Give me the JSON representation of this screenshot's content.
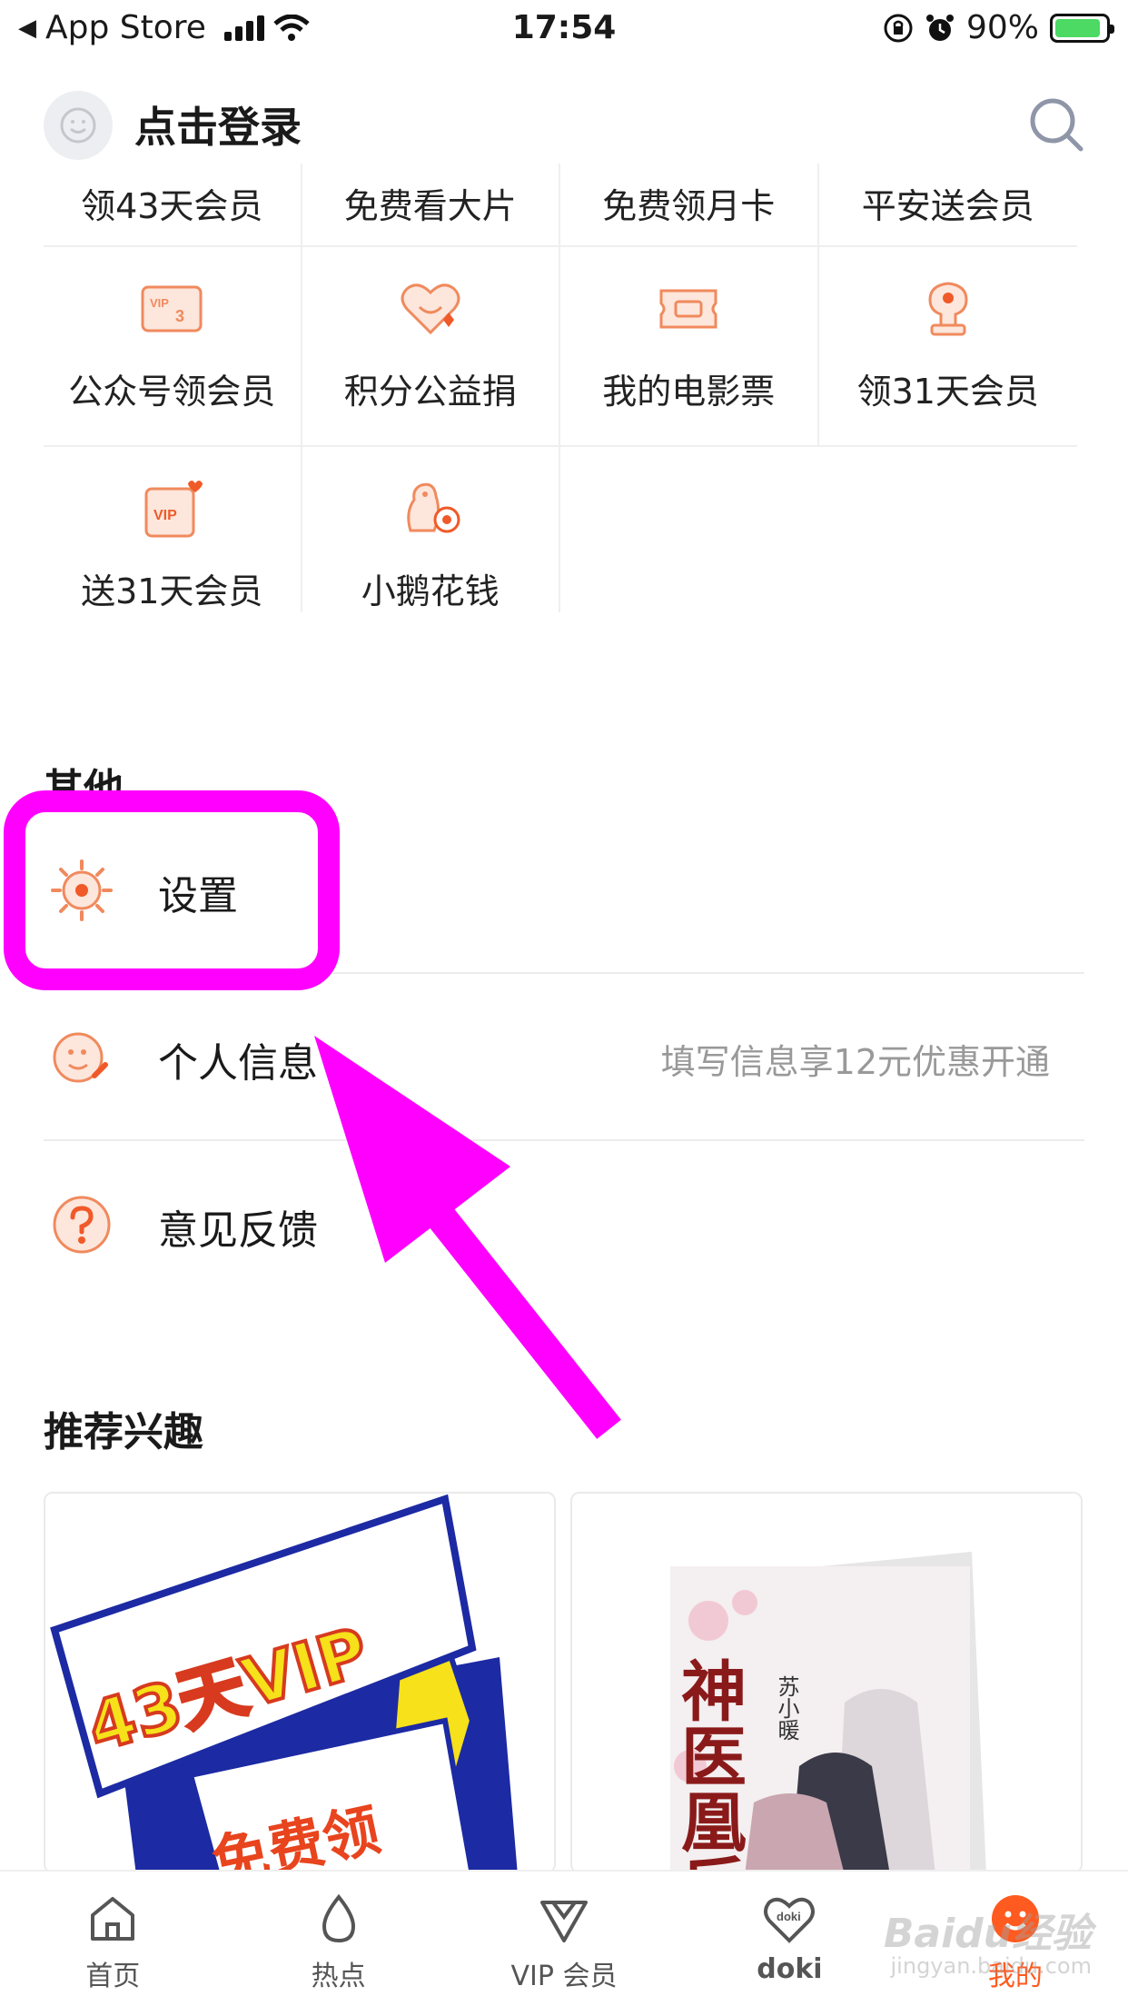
{
  "status_bar": {
    "back_app": "App Store",
    "time": "17:54",
    "battery": "90%"
  },
  "header": {
    "login_title": "点击登录"
  },
  "services": {
    "row_cut": [
      "领43天会员",
      "免费看大片",
      "免费领月卡",
      "平安送会员"
    ],
    "row_a": [
      "公众号领会员",
      "积分公益捐",
      "我的电影票",
      "领31天会员"
    ],
    "row_b": [
      "送31天会员",
      "小鹅花钱"
    ]
  },
  "other": {
    "title": "其他",
    "items": [
      {
        "label": "设置",
        "hint": ""
      },
      {
        "label": "个人信息",
        "hint": "填写信息享12元优惠开通"
      },
      {
        "label": "意见反馈",
        "hint": ""
      }
    ]
  },
  "recommend": {
    "title": "推荐兴趣",
    "card1_line1": "43天VIP",
    "card1_line2": "免费领",
    "card2_title": "神医凰后",
    "card2_author": "苏小暖"
  },
  "tabbar": {
    "tabs": [
      "首页",
      "热点",
      "VIP 会员",
      "doki",
      "我的"
    ],
    "doki_badge": "doki"
  },
  "watermark": {
    "main": "Baidu经验",
    "sub": "jingyan.baidu.com"
  },
  "colors": {
    "accent": "#ff5a1f",
    "icon_orange": "#f08a5d",
    "annotation": "#ff00ff"
  }
}
